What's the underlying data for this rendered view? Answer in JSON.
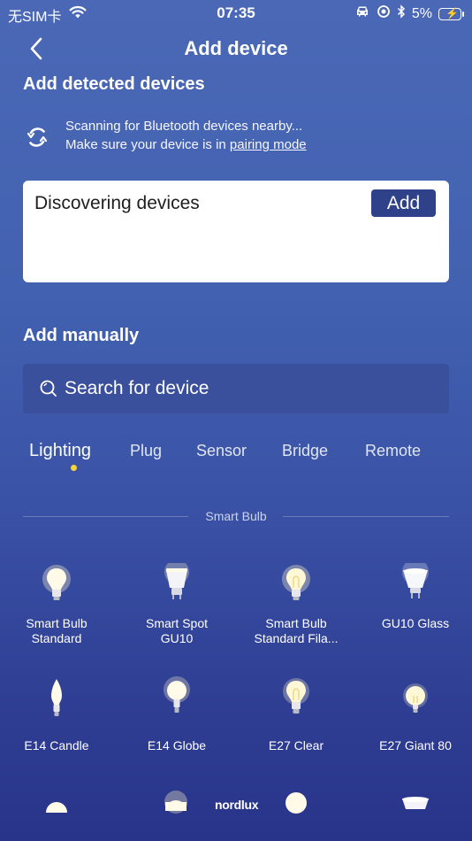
{
  "status_bar": {
    "carrier": "无SIM卡",
    "time": "07:35",
    "battery": "5%"
  },
  "header": {
    "title": "Add device"
  },
  "detected": {
    "title": "Add detected devices",
    "scan_line1": "Scanning for Bluetooth devices nearby...",
    "scan_line2_prefix": "Make sure your device is in ",
    "pairing_link": "pairing mode",
    "card_title": "Discovering devices",
    "add_button": "Add"
  },
  "manual": {
    "title": "Add manually",
    "search_placeholder": "Search for device"
  },
  "tabs": [
    {
      "label": "Lighting",
      "active": true
    },
    {
      "label": "Plug"
    },
    {
      "label": "Sensor"
    },
    {
      "label": "Bridge"
    },
    {
      "label": "Remote"
    }
  ],
  "category": {
    "label": "Smart Bulb"
  },
  "products": [
    {
      "line1": "Smart Bulb",
      "line2": "Standard",
      "icon": "smart-bulb-standard-icon"
    },
    {
      "line1": "Smart Spot",
      "line2": "GU10",
      "icon": "smart-spot-gu10-icon"
    },
    {
      "line1": "Smart Bulb",
      "line2": "Standard Fila...",
      "icon": "smart-bulb-filament-icon"
    },
    {
      "line1": "GU10 Glass",
      "line2": "",
      "icon": "gu10-glass-icon"
    },
    {
      "line1": "E14 Candle",
      "line2": "",
      "icon": "e14-candle-icon"
    },
    {
      "line1": "E14 Globe",
      "line2": "",
      "icon": "e14-globe-icon"
    },
    {
      "line1": "E27 Clear",
      "line2": "",
      "icon": "e27-clear-icon"
    },
    {
      "line1": "E27 Giant 80",
      "line2": "",
      "icon": "e27-giant-80-icon"
    }
  ],
  "footer": {
    "logo": "nordlux"
  },
  "colors": {
    "background_top": "#4a68b6",
    "background_bottom": "#28348a",
    "add_button": "#2f4189",
    "search_box": "#3a509c",
    "tab_indicator": "#f3d53a"
  }
}
